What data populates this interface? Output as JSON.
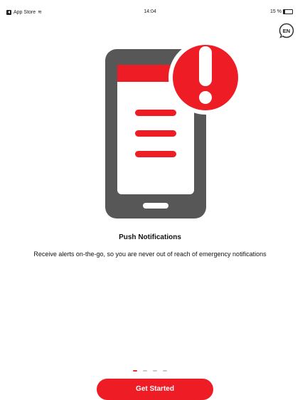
{
  "status_bar": {
    "carrier": "App Store",
    "time": "14:04",
    "battery": "15 %"
  },
  "language": {
    "label": "EN"
  },
  "hero": {
    "icon": "phone-alert-icon"
  },
  "onboarding": {
    "title": "Push Notifications",
    "description": "Receive alerts on-the-go, so you are never out of reach of emergency notifications",
    "page_index": 1,
    "page_count": 4
  },
  "cta": {
    "label": "Get Started"
  },
  "colors": {
    "accent": "#ee1c25",
    "phone": "#555555"
  }
}
